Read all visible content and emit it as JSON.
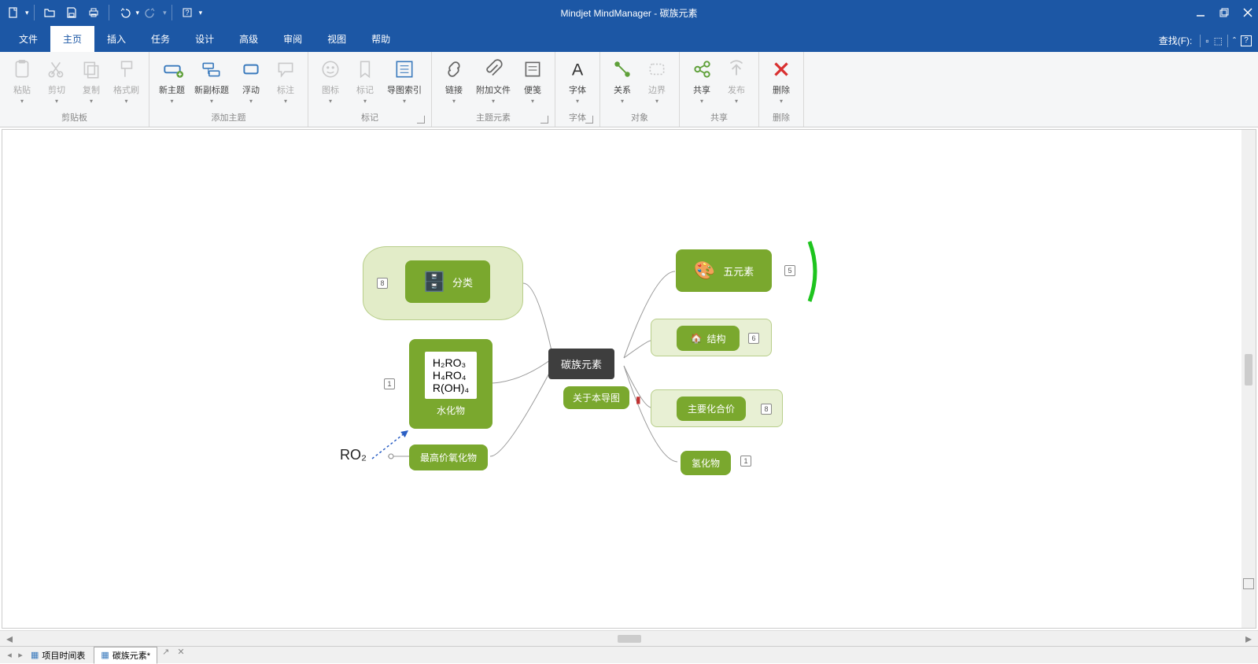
{
  "app": {
    "title": "Mindjet MindManager - 碳族元素"
  },
  "menu": {
    "tabs": [
      "文件",
      "主页",
      "插入",
      "任务",
      "设计",
      "高级",
      "审阅",
      "视图",
      "帮助"
    ],
    "active": 1,
    "searchLabel": "查找(F):"
  },
  "ribbon": {
    "groups": [
      {
        "label": "剪贴板",
        "buttons": [
          {
            "lbl": "粘贴",
            "dim": true
          },
          {
            "lbl": "剪切",
            "dim": true
          },
          {
            "lbl": "复制",
            "dim": true
          },
          {
            "lbl": "格式刷",
            "dim": true
          }
        ]
      },
      {
        "label": "添加主题",
        "buttons": [
          {
            "lbl": "新主题"
          },
          {
            "lbl": "新副标题"
          },
          {
            "lbl": "浮动"
          },
          {
            "lbl": "标注",
            "dim": true
          }
        ]
      },
      {
        "label": "标记",
        "launcher": true,
        "buttons": [
          {
            "lbl": "图标",
            "dim": true
          },
          {
            "lbl": "标记",
            "dim": true
          },
          {
            "lbl": "导图索引"
          }
        ]
      },
      {
        "label": "主题元素",
        "launcher": true,
        "buttons": [
          {
            "lbl": "链接"
          },
          {
            "lbl": "附加文件"
          },
          {
            "lbl": "便笺"
          }
        ]
      },
      {
        "label": "字体",
        "launcher": true,
        "buttons": [
          {
            "lbl": "字体"
          }
        ]
      },
      {
        "label": "对象",
        "buttons": [
          {
            "lbl": "关系"
          },
          {
            "lbl": "边界",
            "dim": true
          }
        ]
      },
      {
        "label": "共享",
        "buttons": [
          {
            "lbl": "共享"
          },
          {
            "lbl": "发布",
            "dim": true
          }
        ]
      },
      {
        "label": "删除",
        "buttons": [
          {
            "lbl": "删除",
            "red": true
          }
        ]
      }
    ]
  },
  "map": {
    "center": "碳族元素",
    "about": "关于本导图",
    "left": {
      "classify": {
        "label": "分类",
        "count": "8"
      },
      "hydrate": {
        "label": "水化物",
        "count": "1",
        "formulas": [
          "H₂RO₃",
          "H₄RO₄",
          "R(OH)₄"
        ]
      },
      "oxide": {
        "label": "最高价氧化物"
      },
      "ro2": "RO₂"
    },
    "right": {
      "five": {
        "label": "五元素",
        "count": "5"
      },
      "structure": {
        "label": "结构",
        "count": "6"
      },
      "valence": {
        "label": "主要化合价",
        "count": "8"
      },
      "hydride": {
        "label": "氢化物",
        "count": "1"
      }
    }
  },
  "doctabs": {
    "tabs": [
      {
        "label": "项目时间表",
        "active": false
      },
      {
        "label": "碳族元素*",
        "active": true
      }
    ]
  }
}
